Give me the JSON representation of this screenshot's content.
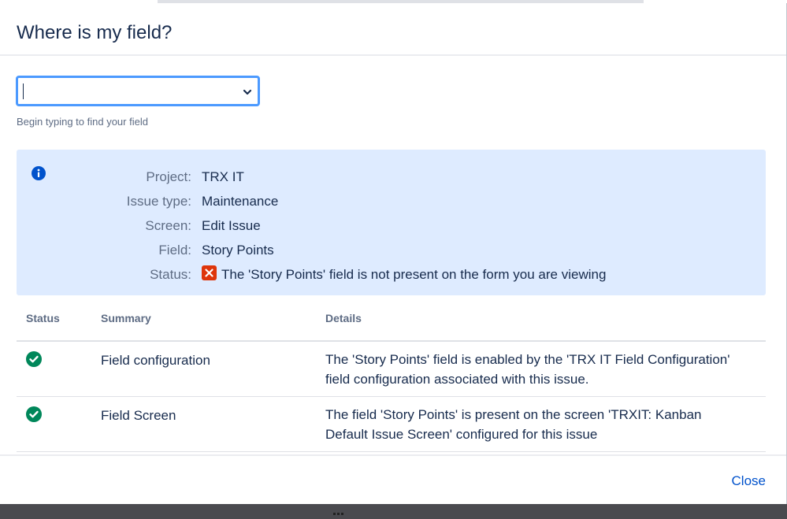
{
  "dialog": {
    "title": "Where is my field?",
    "search": {
      "value": "",
      "placeholder": "",
      "hint": "Begin typing to find your field"
    },
    "info": {
      "rows": [
        {
          "label": "Project:",
          "value": "TRX IT"
        },
        {
          "label": "Issue type:",
          "value": "Maintenance"
        },
        {
          "label": "Screen:",
          "value": "Edit Issue"
        },
        {
          "label": "Field:",
          "value": "Story Points"
        },
        {
          "label": "Status:",
          "value": "The 'Story Points' field is not present on the form you are viewing"
        }
      ]
    },
    "table": {
      "headers": [
        "Status",
        "Summary",
        "Details"
      ],
      "rows": [
        {
          "status_icon": "check-circle-icon",
          "summary": "Field configuration",
          "details_line1": "The 'Story Points' field is enabled by the 'TRX IT Field Configuration'",
          "details_line2": "field configuration associated with this issue."
        },
        {
          "status_icon": "check-circle-icon",
          "summary": "Field Screen",
          "details_line1": "The field 'Story Points' is present on the screen 'TRXIT: Kanban",
          "details_line2": "Default Issue Screen' configured for this issue"
        }
      ]
    },
    "footer": {
      "close_label": "Close"
    }
  },
  "colors": {
    "info_bg": "#deebff",
    "info_icon": "#0052cc",
    "error": "#de350b",
    "success": "#00875a",
    "link": "#0052cc",
    "focus": "#4c9aff"
  }
}
